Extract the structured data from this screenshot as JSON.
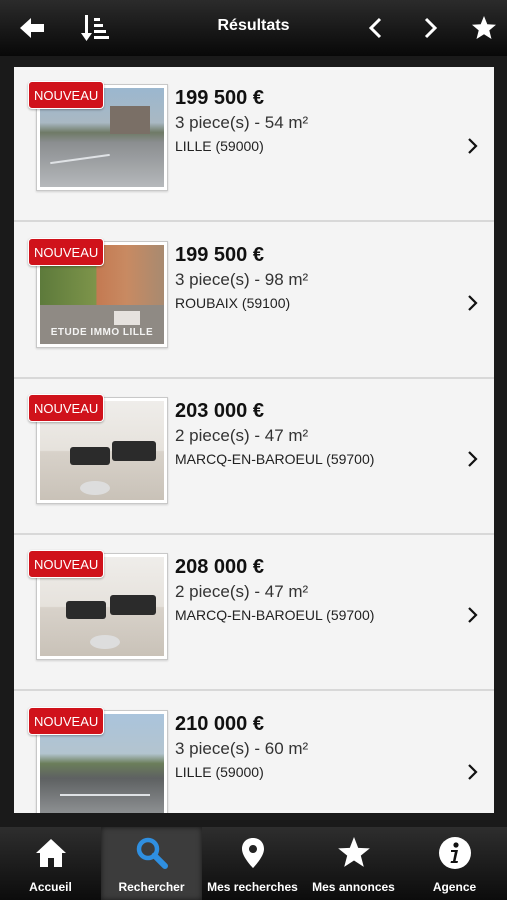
{
  "header": {
    "title": "Résultats"
  },
  "listings": [
    {
      "badge": "NOUVEAU",
      "price": "199 500 €",
      "rooms": "3 piece(s) - 54 m²",
      "city": "LILLE (59000)"
    },
    {
      "badge": "NOUVEAU",
      "price": "199 500 €",
      "rooms": "3 piece(s) - 98 m²",
      "city": "ROUBAIX (59100)",
      "watermark": "ETUDE IMMO LILLE"
    },
    {
      "badge": "NOUVEAU",
      "price": "203 000 €",
      "rooms": "2 piece(s) - 47 m²",
      "city": "MARCQ-EN-BAROEUL (59700)"
    },
    {
      "badge": "NOUVEAU",
      "price": "208 000 €",
      "rooms": "2 piece(s) - 47 m²",
      "city": "MARCQ-EN-BAROEUL (59700)"
    },
    {
      "badge": "NOUVEAU",
      "price": "210 000 €",
      "rooms": "3 piece(s) - 60 m²",
      "city": "LILLE (59000)"
    }
  ],
  "tabs": [
    {
      "label": "Accueil",
      "icon": "home-icon"
    },
    {
      "label": "Rechercher",
      "icon": "search-icon",
      "active": true
    },
    {
      "label": "Mes recherches",
      "icon": "location-pin-icon"
    },
    {
      "label": "Mes annonces",
      "icon": "star-icon"
    },
    {
      "label": "Agence",
      "icon": "info-icon"
    }
  ],
  "colors": {
    "badge": "#d0121b",
    "active_tab_icon": "#2f8fe0",
    "topbar": "#111111"
  }
}
